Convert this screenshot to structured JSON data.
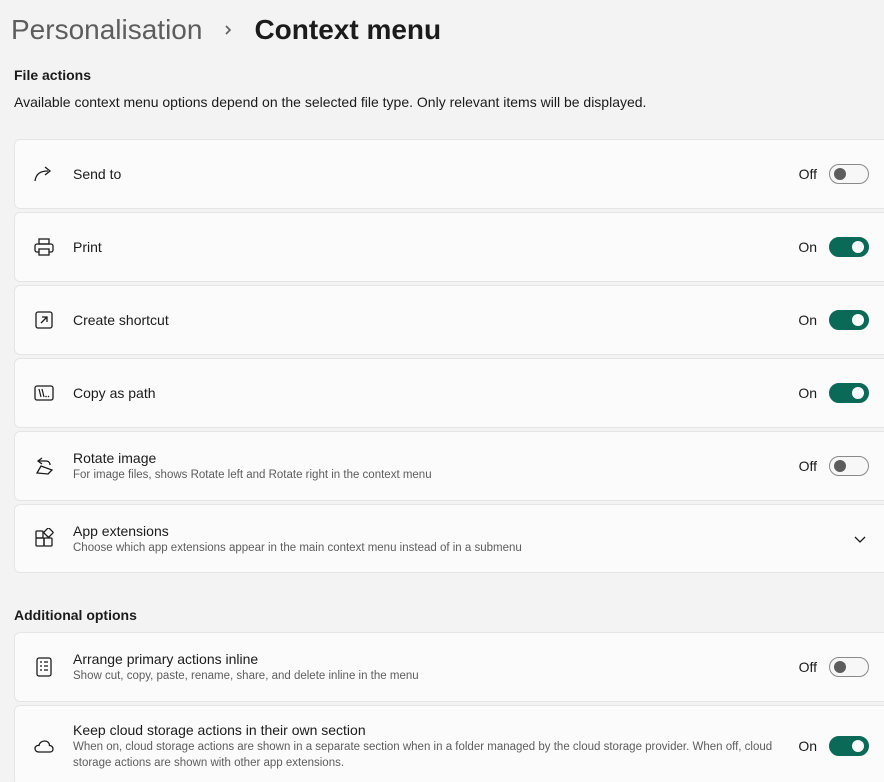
{
  "breadcrumb": {
    "parent": "Personalisation",
    "current": "Context menu"
  },
  "file_actions": {
    "heading": "File actions",
    "description": "Available context menu options depend on the selected file type. Only relevant items will be displayed.",
    "items": [
      {
        "title": "Send to",
        "subtitle": "",
        "state": "Off",
        "icon": "share-arrow-icon"
      },
      {
        "title": "Print",
        "subtitle": "",
        "state": "On",
        "icon": "printer-icon"
      },
      {
        "title": "Create shortcut",
        "subtitle": "",
        "state": "On",
        "icon": "shortcut-icon"
      },
      {
        "title": "Copy as path",
        "subtitle": "",
        "state": "On",
        "icon": "copy-path-icon"
      },
      {
        "title": "Rotate image",
        "subtitle": "For image files, shows Rotate left and Rotate right in the context menu",
        "state": "Off",
        "icon": "rotate-icon"
      },
      {
        "title": "App extensions",
        "subtitle": "Choose which app extensions appear in the main context menu instead of in a submenu",
        "icon": "apps-icon"
      }
    ]
  },
  "additional_options": {
    "heading": "Additional options",
    "items": [
      {
        "title": "Arrange primary actions inline",
        "subtitle": "Show cut, copy, paste, rename, share, and delete inline in the menu",
        "state": "Off",
        "icon": "list-icon"
      },
      {
        "title": "Keep cloud storage actions in their own section",
        "subtitle": "When on, cloud storage actions are shown in a separate section when in a folder managed by the cloud storage provider. When off, cloud storage actions are shown with other app extensions.",
        "state": "On",
        "icon": "cloud-icon"
      }
    ]
  },
  "colors": {
    "accent": "#0b6a57",
    "background": "#f3f3f3",
    "card": "#fbfbfb"
  }
}
